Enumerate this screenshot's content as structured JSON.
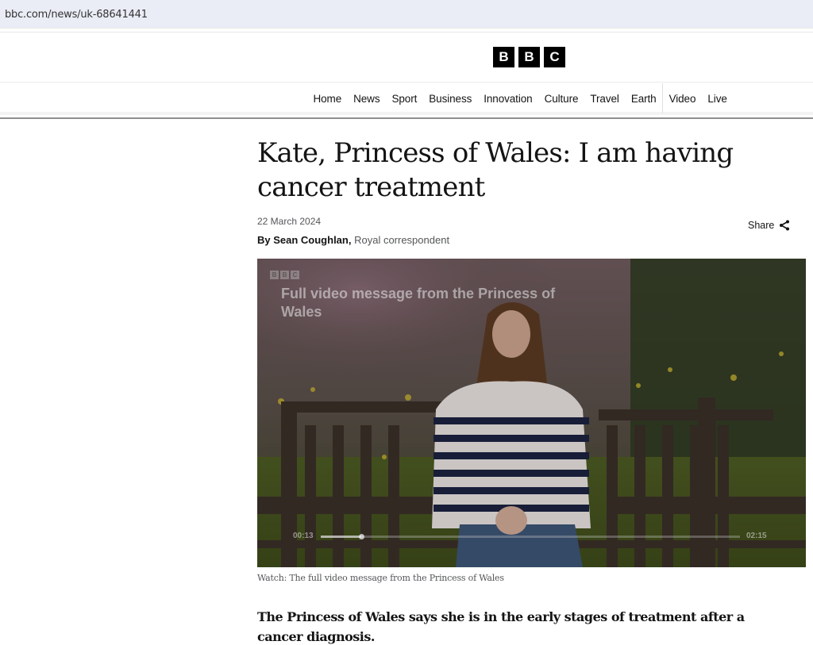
{
  "browser": {
    "url": "bbc.com/news/uk-68641441"
  },
  "masthead": {
    "logo_letters": [
      "B",
      "B",
      "C"
    ]
  },
  "nav": {
    "items": [
      {
        "label": "Home"
      },
      {
        "label": "News"
      },
      {
        "label": "Sport"
      },
      {
        "label": "Business"
      },
      {
        "label": "Innovation"
      },
      {
        "label": "Culture"
      },
      {
        "label": "Travel"
      },
      {
        "label": "Earth"
      },
      {
        "label": "Video"
      },
      {
        "label": "Live"
      }
    ]
  },
  "article": {
    "headline": "Kate, Princess of Wales: I am having cancer treatment",
    "date": "22 March 2024",
    "author": "By Sean Coughlan,",
    "author_role": "Royal correspondent",
    "share_label": "Share",
    "share_icon": "share-icon",
    "video": {
      "overlay_title": "Full video message from the Princess of Wales",
      "overlay_logo": [
        "B",
        "B",
        "C"
      ],
      "current_time": "00:13",
      "duration": "02:15",
      "progress_fraction": 0.096
    },
    "caption": "Watch: The full video message from the Princess of Wales",
    "lede": "The Princess of Wales says she is in the early stages of treatment after a cancer diagnosis."
  }
}
